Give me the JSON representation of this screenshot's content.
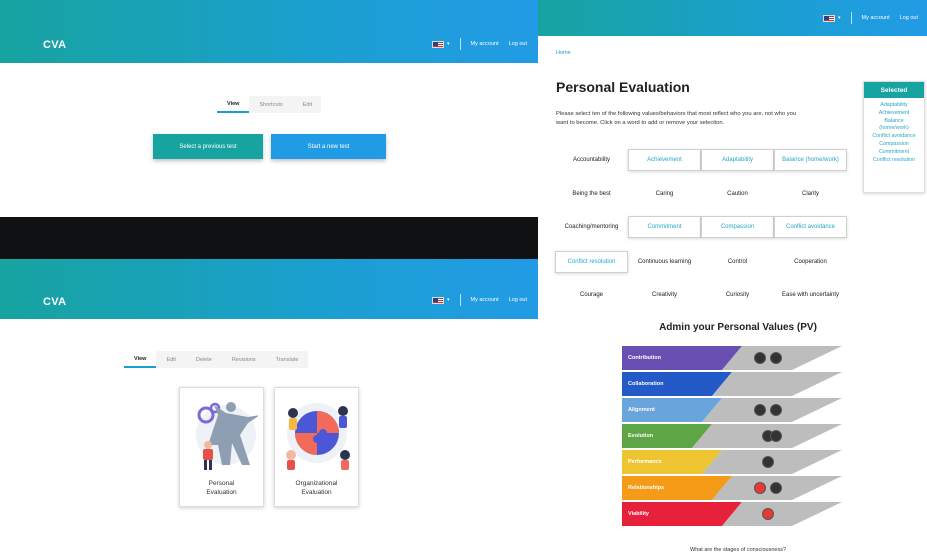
{
  "colors": {
    "header_start": "#17a3a0",
    "header_end": "#229be6",
    "accent": "#1b9fd0",
    "teal_button": "#17a3a0",
    "blue_button": "#229be6",
    "selected_text": "#26a7c7",
    "dot_dark": "#333333",
    "dot_red": "#e53935"
  },
  "header": {
    "brand": "CVA",
    "flag_icon": "us-flag-icon",
    "my_account": "My account",
    "logout": "Log out"
  },
  "panel1": {
    "tabs": [
      "View",
      "Shortcuts",
      "Edit"
    ],
    "select_previous": "Select a previous test",
    "start_new": "Start a new test"
  },
  "panel2": {
    "tabs": [
      "View",
      "Edit",
      "Delete",
      "Revisions",
      "Translate"
    ],
    "cards": [
      {
        "label_line1": "Personal",
        "label_line2": "Evaluation",
        "illustration": "superhero-illustration"
      },
      {
        "label_line1": "Organizational",
        "label_line2": "Evaluation",
        "illustration": "puzzle-team-illustration"
      }
    ]
  },
  "panel3": {
    "breadcrumb": "Home",
    "title": "Personal Evaluation",
    "instructions_line1": "Please select ten of the following values/behaviors that most reflect who you are, not who you",
    "instructions_line2": "want to become. Click on a word to add or remove your selection.",
    "values": [
      {
        "label": "Accountability",
        "selected": false
      },
      {
        "label": "Achievement",
        "selected": true
      },
      {
        "label": "Adaptability",
        "selected": true
      },
      {
        "label": "Balance (home/work)",
        "selected": true
      },
      {
        "label": "Being the best",
        "selected": false
      },
      {
        "label": "Caring",
        "selected": false
      },
      {
        "label": "Caution",
        "selected": false
      },
      {
        "label": "Clarity",
        "selected": false
      },
      {
        "label": "Coaching/mentoring",
        "selected": false
      },
      {
        "label": "Commitment",
        "selected": true
      },
      {
        "label": "Compassion",
        "selected": true
      },
      {
        "label": "Conflict avoidance",
        "selected": true
      },
      {
        "label": "Conflict resolution",
        "selected": true
      },
      {
        "label": "Continuous learning",
        "selected": false
      },
      {
        "label": "Control",
        "selected": false
      },
      {
        "label": "Cooperation",
        "selected": false
      },
      {
        "label": "Courage",
        "selected": false
      },
      {
        "label": "Creativity",
        "selected": false
      },
      {
        "label": "Curiosity",
        "selected": false
      },
      {
        "label": "Ease with uncertainty",
        "selected": false
      }
    ],
    "selected_panel": {
      "title": "Selected",
      "items": [
        "Adaptability",
        "Achievement",
        "Balance",
        "(home/work)",
        "Conflict avoidance",
        "Compassion",
        "Commitment",
        "Conflict resolution"
      ]
    },
    "admin_title": "Admin your Personal Values (PV)",
    "bands": [
      {
        "label": "Contribution",
        "color": "#6a4fb3",
        "dots": [
          "dark",
          "dark"
        ]
      },
      {
        "label": "Collaboration",
        "color": "#2459c8",
        "dots": []
      },
      {
        "label": "Alignment",
        "color": "#6aa4dc",
        "dots": [
          "dark",
          "dark"
        ]
      },
      {
        "label": "Evolution",
        "color": "#5ea545",
        "dots": [
          "dark",
          "dark"
        ]
      },
      {
        "label": "Performance",
        "color": "#efc431",
        "dots": [
          "dark"
        ]
      },
      {
        "label": "Relationships",
        "color": "#f59b17",
        "dots": [
          "red",
          "dark"
        ]
      },
      {
        "label": "Viability",
        "color": "#e8213a",
        "dots": [
          "red"
        ]
      }
    ],
    "footer_question": "What are the stages of consciousness?"
  }
}
